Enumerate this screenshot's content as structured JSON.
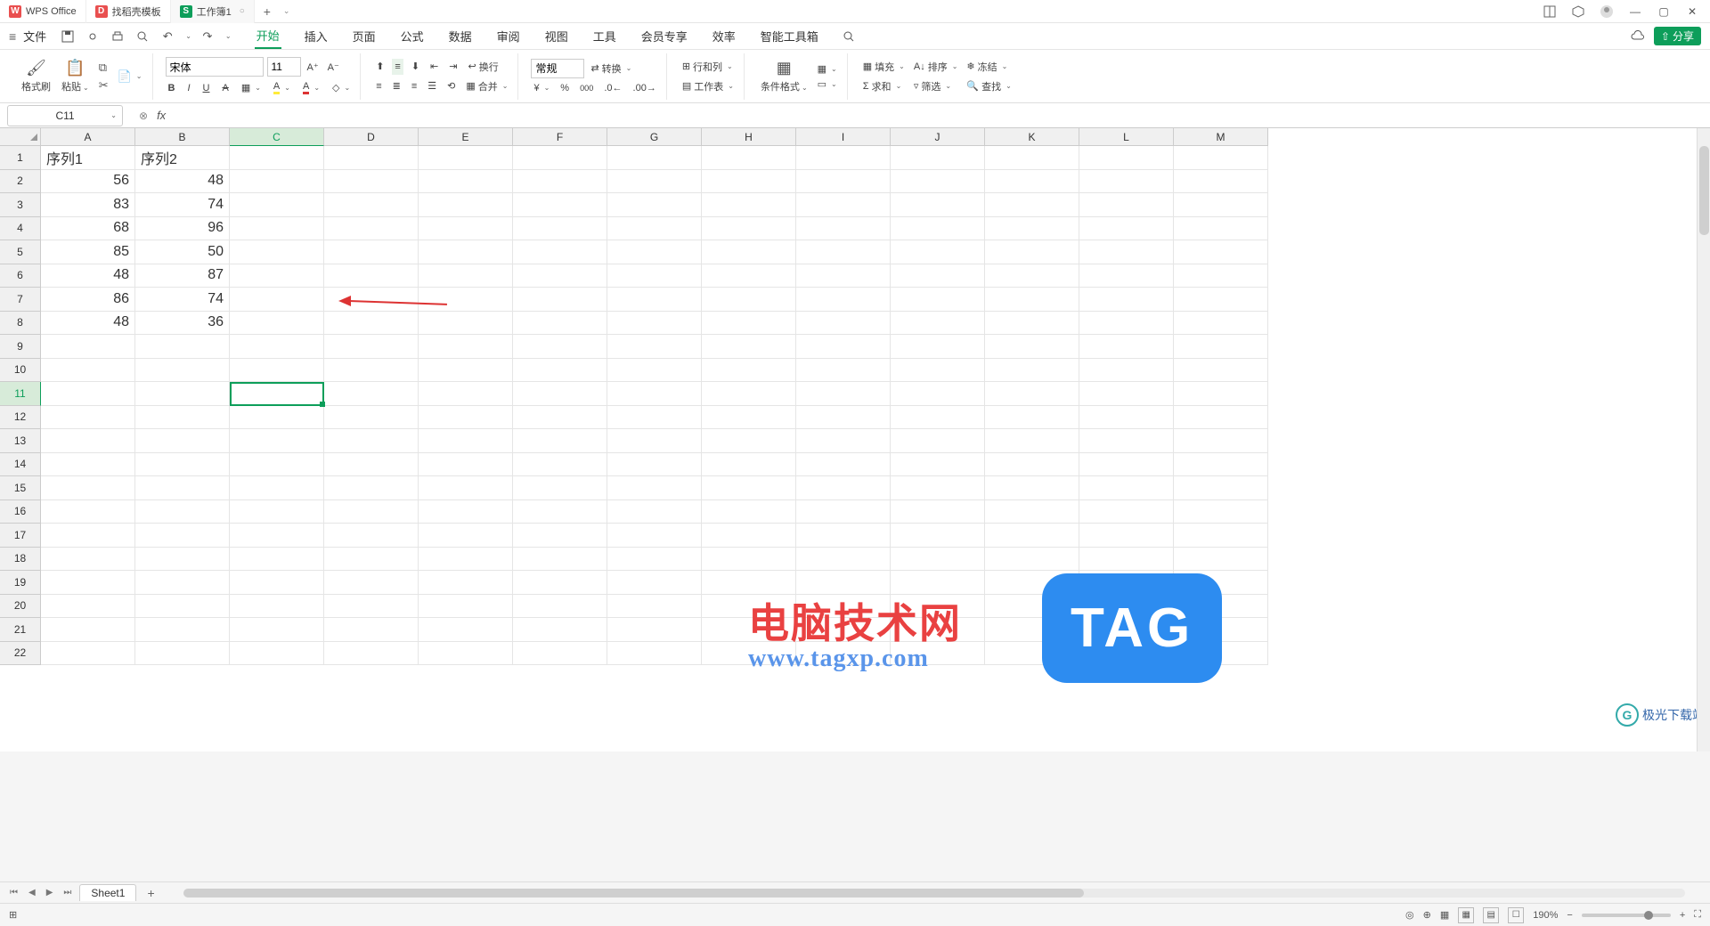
{
  "title_bar": {
    "app_name": "WPS Office",
    "doke_tab": "找稻壳模板",
    "doc_tab": "工作簿1",
    "doc_prefix": "S"
  },
  "menu": {
    "file": "文件",
    "tabs": [
      "开始",
      "插入",
      "页面",
      "公式",
      "数据",
      "审阅",
      "视图",
      "工具",
      "会员专享",
      "效率",
      "智能工具箱"
    ],
    "active_index": 0,
    "share": "分享"
  },
  "ribbon": {
    "format_painter": "格式刷",
    "paste": "粘贴",
    "font_name": "宋体",
    "font_size": "11",
    "wrap": "换行",
    "merge": "合并",
    "number_format": "常规",
    "convert": "转换",
    "rows_cols": "行和列",
    "worksheet": "工作表",
    "cond_format": "条件格式",
    "fill": "填充",
    "sort": "排序",
    "freeze": "冻结",
    "sum": "求和",
    "filter": "筛选",
    "find": "查找"
  },
  "name_box": "C11",
  "fx_label": "fx",
  "columns": [
    "A",
    "B",
    "C",
    "D",
    "E",
    "F",
    "G",
    "H",
    "I",
    "J",
    "K",
    "L",
    "M"
  ],
  "row_count": 22,
  "selected_col_index": 2,
  "selected_row_index": 10,
  "data": {
    "headers": [
      "序列1",
      "序列2"
    ],
    "rows": [
      [
        56,
        48
      ],
      [
        83,
        74
      ],
      [
        68,
        96
      ],
      [
        85,
        50
      ],
      [
        48,
        87
      ],
      [
        86,
        74
      ],
      [
        48,
        36
      ]
    ]
  },
  "sheet_tab": "Sheet1",
  "status": {
    "zoom": "190%"
  },
  "watermark": {
    "title": "电脑技术网",
    "url": "www.tagxp.com",
    "tag": "TAG",
    "dl": "极光下载站"
  }
}
